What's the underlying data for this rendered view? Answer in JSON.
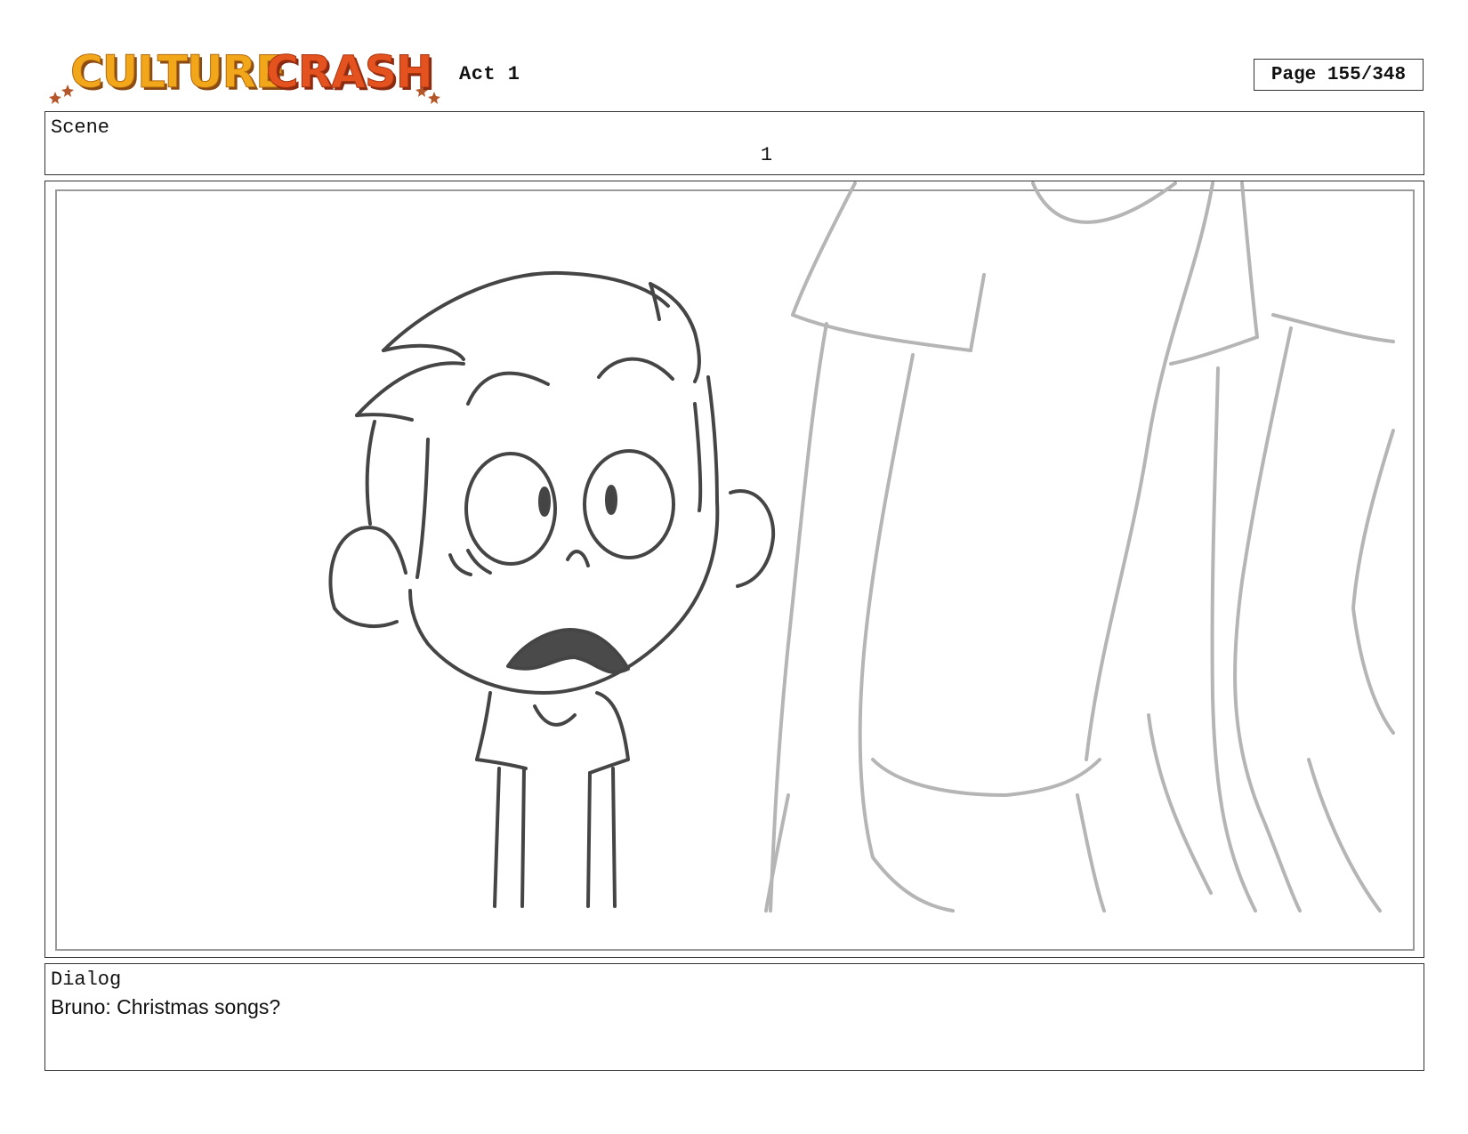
{
  "header": {
    "logo_text": "CULTURE CRASH",
    "act": "Act 1",
    "page": "Page 155/348"
  },
  "scene": {
    "label": "Scene",
    "number": "1"
  },
  "panel": {
    "content": "storyboard-sketch"
  },
  "dialog": {
    "label": "Dialog",
    "text": "Bruno: Christmas songs?"
  },
  "colors": {
    "logo_yellow": "#f2a71b",
    "logo_orange": "#e4521f",
    "logo_star": "#c0392b",
    "sketch_dark": "#444444",
    "sketch_light": "#b5b5b5"
  }
}
